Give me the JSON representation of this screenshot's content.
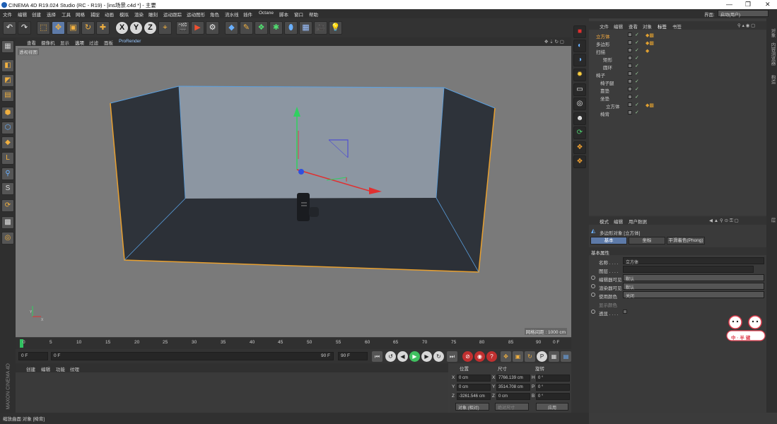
{
  "titlebar": {
    "title": "CINEMA 4D R19.024 Studio (RC - R19) - [ins场景.c4d *] - 主要",
    "minimize": "—",
    "maximize": "❐",
    "close": "✕"
  },
  "menubar": [
    "文件",
    "编辑",
    "创建",
    "选择",
    "工具",
    "网格",
    "捕捉",
    "动画",
    "模拟",
    "渲染",
    "雕刻",
    "运动跟踪",
    "运动图形",
    "角色",
    "流水线",
    "插件",
    "Octane",
    "脚本",
    "窗口",
    "帮助"
  ],
  "interface": {
    "label": "界面:",
    "value": "启动(用户)"
  },
  "viewport": {
    "menu": [
      "查看",
      "摄像机",
      "显示",
      "选项",
      "过滤",
      "面板",
      "ProRender"
    ],
    "tag": "透视视图",
    "grid_label": "网格间距 : 1000 cm"
  },
  "timeline": {
    "ticks": [
      "0",
      "5",
      "10",
      "15",
      "20",
      "25",
      "30",
      "35",
      "40",
      "45",
      "50",
      "55",
      "60",
      "65",
      "70",
      "75",
      "80",
      "85",
      "90"
    ],
    "end_field": "0 F"
  },
  "transport": {
    "start": "0 F",
    "slider_start": "0 F",
    "slider_end": "90 F",
    "end": "90 F"
  },
  "material": {
    "menu": [
      "创建",
      "编辑",
      "功能",
      "纹理"
    ]
  },
  "brand": "MAXON CINEMA 4D",
  "coords": {
    "headers": [
      "位置",
      "尺寸",
      "旋转"
    ],
    "rows": [
      {
        "axis": "X",
        "pos": "0 cm",
        "size_axis": "X",
        "size": "7766.139 cm",
        "rot_axis": "H",
        "rot": "0 °"
      },
      {
        "axis": "Y",
        "pos": "0 cm",
        "size_axis": "Y",
        "size": "3514.708 cm",
        "rot_axis": "P",
        "rot": "0 °"
      },
      {
        "axis": "Z",
        "pos": "-3261.546 cm",
        "size_axis": "Z",
        "size": "0 cm",
        "rot_axis": "B",
        "rot": "0 °"
      }
    ],
    "mode": "对象 (相对)",
    "size_mode": "绝对尺寸",
    "apply": "应用"
  },
  "status": "缩放曲面 对象 [椅背]",
  "objects": {
    "menu": [
      "文件",
      "编辑",
      "查看",
      "对象",
      "标签",
      "书签"
    ],
    "rows": [
      {
        "name": "立方体",
        "indent": 1,
        "highlight": true
      },
      {
        "name": "多边形",
        "indent": 1,
        "highlight": false
      },
      {
        "name": "扫描",
        "indent": 1,
        "highlight": false
      },
      {
        "name": "矩形",
        "indent": 2,
        "highlight": false
      },
      {
        "name": "圆环",
        "indent": 2,
        "highlight": false
      },
      {
        "name": "椅子",
        "indent": 1,
        "highlight": false
      },
      {
        "name": "椅子腿",
        "indent": 2,
        "highlight": false
      },
      {
        "name": "靠垫",
        "indent": 2,
        "highlight": false
      },
      {
        "name": "坐垫",
        "indent": 2,
        "highlight": false
      },
      {
        "name": "立方体",
        "indent": 3,
        "highlight": false
      },
      {
        "name": "椅背",
        "indent": 2,
        "highlight": false
      }
    ]
  },
  "side_tabs": [
    "对象",
    "内容浏览器",
    "构造",
    "层"
  ],
  "attributes": {
    "menu": [
      "模式",
      "编辑",
      "用户数据"
    ],
    "object_title": "多边形对象 [立方体]",
    "tabs": [
      "基本",
      "坐标",
      "平滑着色(Phong)"
    ],
    "section": "基本属性",
    "fields": [
      {
        "label": "名称 . . . .",
        "value": "立方体"
      },
      {
        "label": "图层 . . . .",
        "value": ""
      },
      {
        "label": "编辑器可见",
        "value": "默认"
      },
      {
        "label": "渲染器可见",
        "value": "默认"
      },
      {
        "label": "使用颜色",
        "value": "关闭"
      },
      {
        "label": "显示颜色",
        "value": ""
      },
      {
        "label": "透显 . . . .",
        "value": ""
      }
    ]
  },
  "sticker_text": "中 ◦ 半 键",
  "colors": {
    "viewport_bg": "#7a7a7a",
    "wall": "#2e333a",
    "floor": "#2b2f36",
    "back_wall": "#8d97a3",
    "edge": "#e8a030",
    "edge_top": "#5aa0e0"
  }
}
